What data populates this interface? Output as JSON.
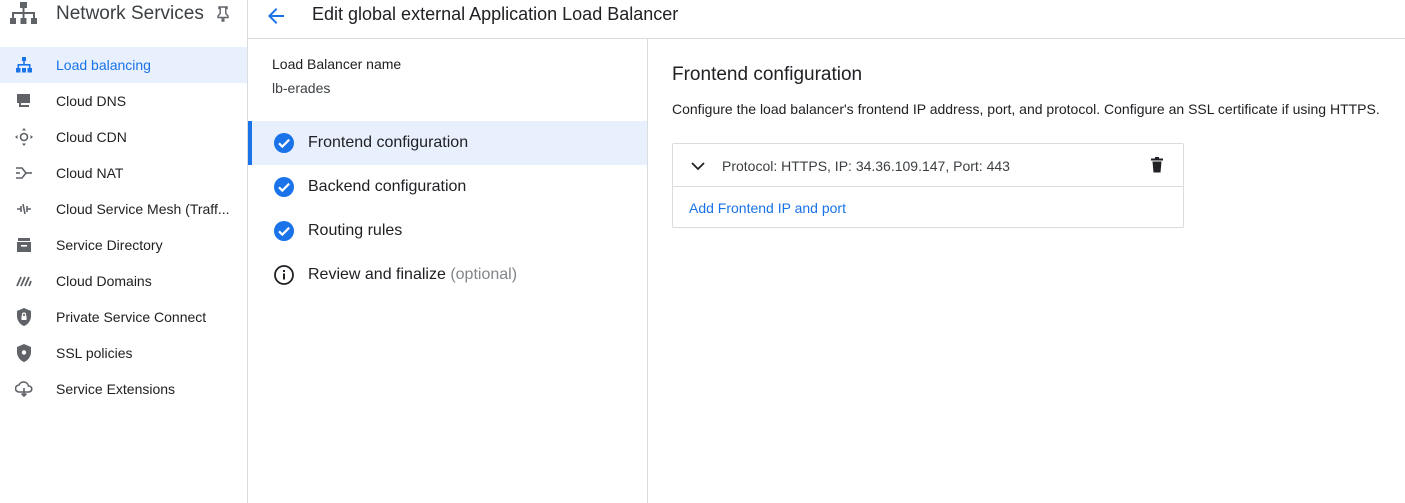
{
  "sidebar": {
    "product_title": "Network Services",
    "product_icon": "network-services-icon",
    "pin_icon": "pin-icon",
    "items": [
      {
        "label": "Load balancing",
        "icon": "load-balancing-icon",
        "active": true
      },
      {
        "label": "Cloud DNS",
        "icon": "cloud-dns-icon",
        "active": false
      },
      {
        "label": "Cloud CDN",
        "icon": "cloud-cdn-icon",
        "active": false
      },
      {
        "label": "Cloud NAT",
        "icon": "cloud-nat-icon",
        "active": false
      },
      {
        "label": "Cloud Service Mesh (Traff...",
        "icon": "service-mesh-icon",
        "active": false
      },
      {
        "label": "Service Directory",
        "icon": "service-directory-icon",
        "active": false
      },
      {
        "label": "Cloud Domains",
        "icon": "cloud-domains-icon",
        "active": false
      },
      {
        "label": "Private Service Connect",
        "icon": "private-service-connect-icon",
        "active": false
      },
      {
        "label": "SSL policies",
        "icon": "ssl-policies-icon",
        "active": false
      },
      {
        "label": "Service Extensions",
        "icon": "service-extensions-icon",
        "active": false
      }
    ]
  },
  "header": {
    "back_icon": "arrow-back-icon",
    "title": "Edit global external Application Load Balancer"
  },
  "steps_panel": {
    "lb_name_label": "Load Balancer name",
    "lb_name_value": "lb-erades",
    "steps": [
      {
        "label": "Frontend configuration",
        "status": "complete",
        "optional_text": "",
        "active": true
      },
      {
        "label": "Backend configuration",
        "status": "complete",
        "optional_text": "",
        "active": false
      },
      {
        "label": "Routing rules",
        "status": "complete",
        "optional_text": "",
        "active": false
      },
      {
        "label": "Review and finalize",
        "status": "info",
        "optional_text": "(optional)",
        "active": false
      }
    ]
  },
  "config": {
    "title": "Frontend configuration",
    "description": "Configure the load balancer's frontend IP address, port, and protocol. Configure an SSL certificate if using HTTPS.",
    "frontend_entry": "Protocol: HTTPS, IP: 34.36.109.147, Port: 443",
    "add_link": "Add Frontend IP and port"
  },
  "colors": {
    "accent": "#1a73e8",
    "active_bg": "#e8f0fe",
    "border": "#dadce0",
    "text": "#202124",
    "icon": "#5f6368"
  }
}
